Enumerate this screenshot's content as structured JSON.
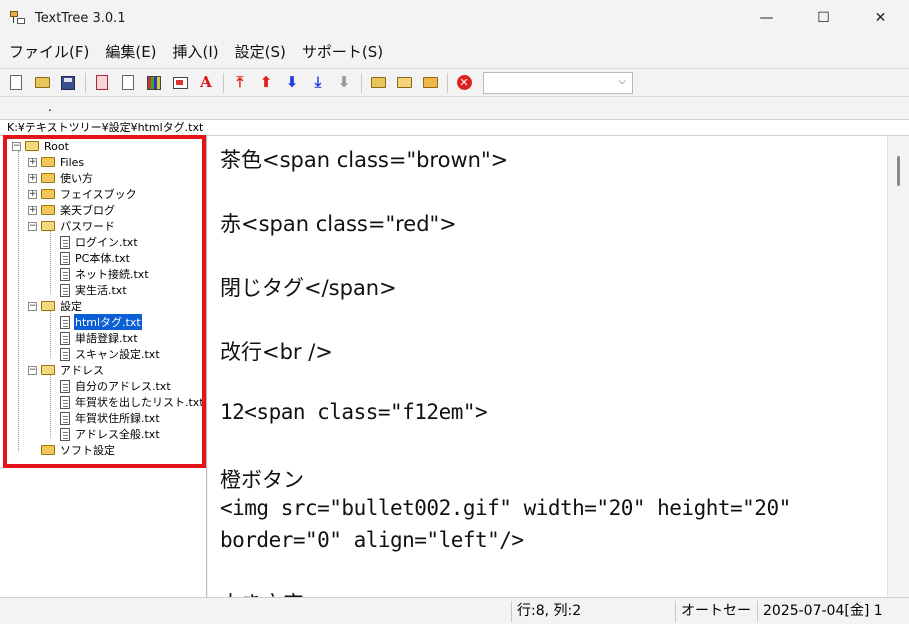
{
  "window": {
    "title": "TextTree 3.0.1",
    "controls": [
      "—",
      "☐",
      "✕"
    ]
  },
  "menu": [
    "ファイル(F)",
    "編集(E)",
    "挿入(I)",
    "設定(S)",
    "サポート(S)"
  ],
  "toolbar": {
    "icons": [
      "new-document-icon",
      "open-folder-icon",
      "save-icon",
      "red-document-icon",
      "document-icon",
      "books-icon",
      "card-icon",
      "font-icon",
      "move-top-icon",
      "move-up-icon",
      "move-down-icon",
      "move-bottom-icon",
      "move-disabled-icon",
      "folder-icon",
      "folder-open-icon",
      "folder-edit-icon",
      "stop-icon"
    ],
    "combo_value": ""
  },
  "tab": {
    "label": "."
  },
  "path": "K:¥テキストツリー¥設定¥htmlタグ.txt",
  "tree": {
    "root": "Root",
    "items": [
      {
        "label": "Files",
        "type": "folder",
        "level": 1,
        "expander": "+"
      },
      {
        "label": "使い方",
        "type": "folder",
        "level": 1,
        "expander": "+"
      },
      {
        "label": "フェイスブック",
        "type": "folder",
        "level": 1,
        "expander": "+"
      },
      {
        "label": "楽天ブログ",
        "type": "folder",
        "level": 1,
        "expander": "+"
      },
      {
        "label": "パスワード",
        "type": "folder-open",
        "level": 1,
        "expander": "−"
      },
      {
        "label": "ログイン.txt",
        "type": "file",
        "level": 2
      },
      {
        "label": "PC本体.txt",
        "type": "file",
        "level": 2
      },
      {
        "label": "ネット接続.txt",
        "type": "file",
        "level": 2
      },
      {
        "label": "実生活.txt",
        "type": "file",
        "level": 2
      },
      {
        "label": "設定",
        "type": "folder-open",
        "level": 1,
        "expander": "−"
      },
      {
        "label": "htmlタグ.txt",
        "type": "file",
        "level": 2,
        "selected": true
      },
      {
        "label": "単語登録.txt",
        "type": "file",
        "level": 2
      },
      {
        "label": "スキャン設定.txt",
        "type": "file",
        "level": 2
      },
      {
        "label": "アドレス",
        "type": "folder-open",
        "level": 1,
        "expander": "−"
      },
      {
        "label": "自分のアドレス.txt",
        "type": "file",
        "level": 2
      },
      {
        "label": "年賀状を出したリスト.txt",
        "type": "file",
        "level": 2
      },
      {
        "label": "年賀状住所録.txt",
        "type": "file",
        "level": 2
      },
      {
        "label": "アドレス全般.txt",
        "type": "file",
        "level": 2
      },
      {
        "label": "ソフト設定",
        "type": "folder",
        "level": 1
      }
    ]
  },
  "editor": {
    "lines": [
      "茶色<span class=\"brown\">",
      "",
      "赤<span class=\"red\">",
      "",
      "閉じタグ</span>",
      "",
      "改行<br />",
      "",
      "12<span class=\"f12em\">",
      "",
      "橙ボタン",
      "<img src=\"bullet002.gif\" width=\"20\" height=\"20\"",
      "border=\"0\" align=\"left\"/>",
      "",
      "大き文字"
    ]
  },
  "status": {
    "position": "行:8, 列:2",
    "mode": "オートセー",
    "date": "2025-07-04[金] 1"
  },
  "colors": {
    "highlight_border": "#e4141b",
    "selection": "#0a5fd6"
  }
}
